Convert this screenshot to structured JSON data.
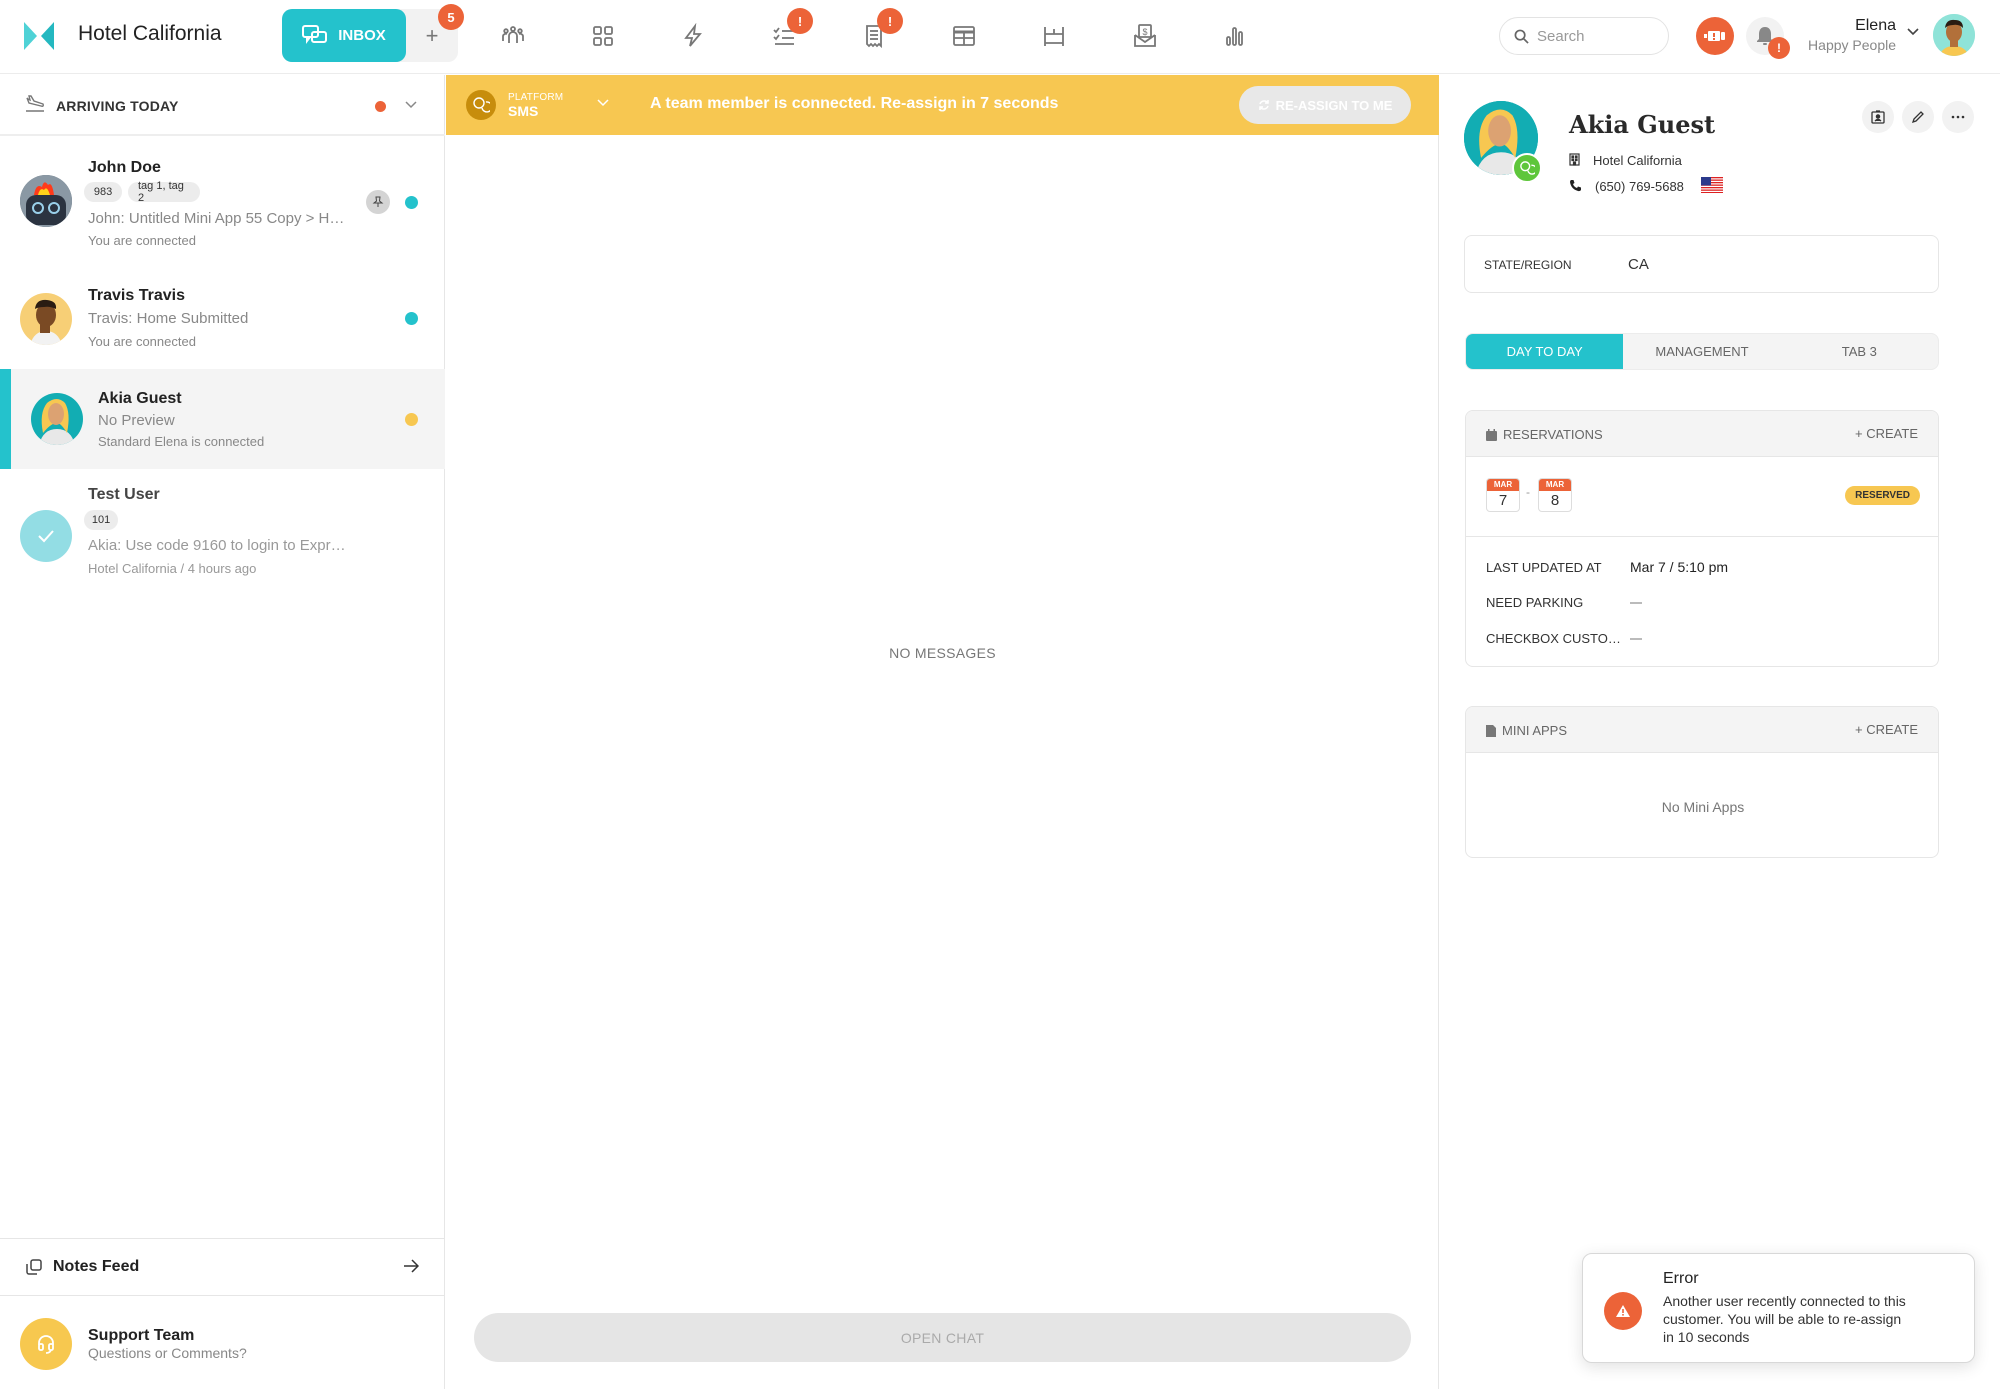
{
  "app": {
    "title": "Hotel California",
    "brand_color": "#24c2cc",
    "alert_color": "#ec6338"
  },
  "topbar": {
    "inbox_label": "INBOX",
    "plus_label": "+",
    "plus_badge": "5",
    "nav_icons": [
      {
        "name": "team-icon",
        "badge": ""
      },
      {
        "name": "apps-grid-icon",
        "badge": ""
      },
      {
        "name": "lightning-icon",
        "badge": ""
      },
      {
        "name": "tasks-icon",
        "badge": "!"
      },
      {
        "name": "receipt-icon",
        "badge": "!"
      },
      {
        "name": "table-icon",
        "badge": ""
      },
      {
        "name": "bed-icon",
        "badge": ""
      },
      {
        "name": "payment-icon",
        "badge": ""
      },
      {
        "name": "analytics-icon",
        "badge": ""
      }
    ],
    "search_placeholder": "Search",
    "bell_badge": "!",
    "user": {
      "name": "Elena",
      "org": "Happy People"
    }
  },
  "sidebar": {
    "filter_label": "ARRIVING TODAY",
    "conversations": [
      {
        "name": "John Doe",
        "tags": [
          "983",
          "tag 1, tag 2"
        ],
        "preview": "John: Untitled Mini App 55 Copy > H…",
        "status": "You are connected",
        "dot_color": "#24c2cc",
        "pinned": true,
        "selected": false
      },
      {
        "name": "Travis Travis",
        "tags": [],
        "preview": "Travis: Home Submitted",
        "status": "You are connected",
        "dot_color": "#24c2cc",
        "pinned": false,
        "selected": false
      },
      {
        "name": "Akia Guest",
        "tags": [],
        "preview": "No Preview",
        "status": "Standard Elena is connected",
        "dot_color": "#f7c751",
        "pinned": false,
        "selected": true
      },
      {
        "name": "Test User",
        "tags": [
          "101"
        ],
        "preview": "Akia: Use code 9160 to login to Expr…",
        "status": "Hotel California / 4 hours ago",
        "dot_color": "",
        "pinned": false,
        "selected": false
      }
    ],
    "notes_feed_label": "Notes Feed",
    "support": {
      "name": "Support Team",
      "subtitle": "Questions or Comments?"
    }
  },
  "center": {
    "banner": {
      "platform_label": "PLATFORM",
      "platform_value": "SMS",
      "message": "A team member is connected. Re-assign in 7 seconds",
      "reassign_label": "RE-ASSIGN TO ME"
    },
    "empty_label": "NO MESSAGES",
    "open_chat_label": "OPEN CHAT"
  },
  "profile": {
    "name": "Akia Guest",
    "org": "Hotel California",
    "phone": "(650) 769-5688",
    "state_label": "STATE/REGION",
    "state_value": "CA",
    "tabs": [
      {
        "label": "DAY TO DAY",
        "active": true
      },
      {
        "label": "MANAGEMENT",
        "active": false
      },
      {
        "label": "TAB 3",
        "active": false
      }
    ],
    "reservations": {
      "title": "RESERVATIONS",
      "create_label": "+ CREATE",
      "start": {
        "month": "MAR",
        "day": "7"
      },
      "separator": "-",
      "end": {
        "month": "MAR",
        "day": "8"
      },
      "status": "RESERVED",
      "fields": [
        {
          "label": "LAST UPDATED AT",
          "value": "Mar 7 / 5:10 pm"
        },
        {
          "label": "NEED PARKING",
          "value": "—"
        },
        {
          "label": "CHECKBOX CUSTO…",
          "value": "—"
        }
      ]
    },
    "mini_apps": {
      "title": "MINI APPS",
      "create_label": "+ CREATE",
      "empty": "No Mini Apps"
    }
  },
  "toast": {
    "title": "Error",
    "message": "Another user recently connected to this customer. You will be able to re-assign in 10 seconds"
  }
}
